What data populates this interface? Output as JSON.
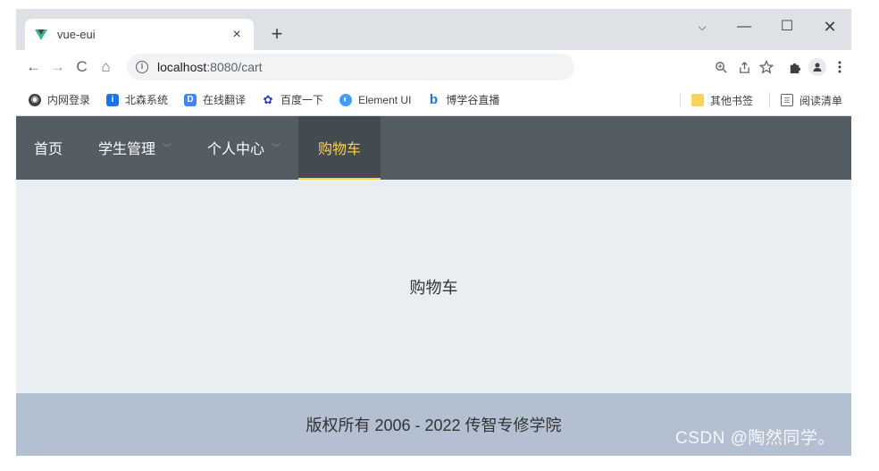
{
  "browser": {
    "tab": {
      "title": "vue-eui",
      "close": "×"
    },
    "new_tab": "+",
    "window": {
      "dropdown": "⌵",
      "minimize": "—",
      "maximize": "☐",
      "close": "✕"
    },
    "toolbar": {
      "back": "←",
      "forward": "→",
      "reload": "C",
      "home": "⌂",
      "url_host": "localhost",
      "url_path": ":8080/cart",
      "info_icon": "i"
    },
    "bookmarks": [
      {
        "label": "内网登录",
        "icon": "globe-icon",
        "color": "#3c4043",
        "glyph": "◉"
      },
      {
        "label": "北森系统",
        "icon": "info-icon",
        "color": "#1a73e8",
        "glyph": "i"
      },
      {
        "label": "在线翻译",
        "icon": "translate-icon",
        "color": "#4285f4",
        "glyph": "D"
      },
      {
        "label": "百度一下",
        "icon": "baidu-paw-icon",
        "color": "#2932e1",
        "glyph": "✿"
      },
      {
        "label": "Element UI",
        "icon": "element-icon",
        "color": "#409eff",
        "glyph": "◐"
      },
      {
        "label": "博学谷直播",
        "icon": "bing-icon",
        "color": "#1d74d8",
        "glyph": "b"
      }
    ],
    "bookmarks_right": [
      {
        "label": "其他书签",
        "icon": "folder-icon",
        "color": "#fbd35b"
      },
      {
        "label": "阅读清单",
        "icon": "reading-list-icon",
        "color": "#5f6368"
      }
    ]
  },
  "page": {
    "menu": [
      {
        "label": "首页",
        "has_arrow": false,
        "active": false
      },
      {
        "label": "学生管理",
        "has_arrow": true,
        "active": false
      },
      {
        "label": "个人中心",
        "has_arrow": true,
        "active": false
      },
      {
        "label": "购物车",
        "has_arrow": false,
        "active": true
      }
    ],
    "main_text": "购物车",
    "footer_text": "版权所有 2006 - 2022 传智专修学院"
  },
  "watermark": "CSDN @陶然同学。",
  "colors": {
    "menu_bg": "#545c64",
    "menu_active_text": "#ffd04b",
    "main_bg": "#e9eef3",
    "footer_bg": "#b3c0d1"
  }
}
